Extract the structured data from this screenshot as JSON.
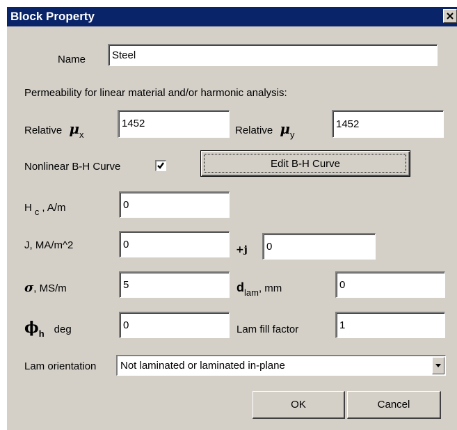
{
  "dialog": {
    "title": "Block Property",
    "close_glyph": "✕"
  },
  "name": {
    "label": "Name",
    "value": "Steel"
  },
  "permeability": {
    "heading": "Permeability for linear material and/or harmonic analysis:",
    "relative_label": "Relative",
    "mu_symbol": "μ",
    "x_sub": "x",
    "y_sub": "y",
    "mu_x_value": "1452",
    "mu_y_value": "1452"
  },
  "nonlinear": {
    "label": "Nonlinear B-H Curve",
    "checked": true,
    "edit_button_label": "Edit B-H Curve"
  },
  "hc": {
    "symbol": "H",
    "sub": "c",
    "unit": ", A/m",
    "value": "0"
  },
  "j": {
    "label": "J, MA/m^2",
    "imag_label": "+j",
    "value": "0",
    "imag_value": "0"
  },
  "sigma": {
    "symbol": "σ",
    "unit": ", MS/m",
    "value": "5"
  },
  "dlam": {
    "symbol": "d",
    "sub": "lam",
    "unit": ", mm",
    "value": "0"
  },
  "phi": {
    "symbol": "ϕ",
    "sub": "h",
    "unit": "deg",
    "value": "0"
  },
  "lam_fill": {
    "label": "Lam fill factor",
    "value": "1"
  },
  "lam_orientation": {
    "label": "Lam orientation",
    "selected": "Not laminated or laminated in-plane"
  },
  "buttons": {
    "ok": "OK",
    "cancel": "Cancel"
  },
  "icons": {
    "close": "close-icon",
    "check": "check-icon",
    "dropdown": "chevron-down-icon"
  }
}
